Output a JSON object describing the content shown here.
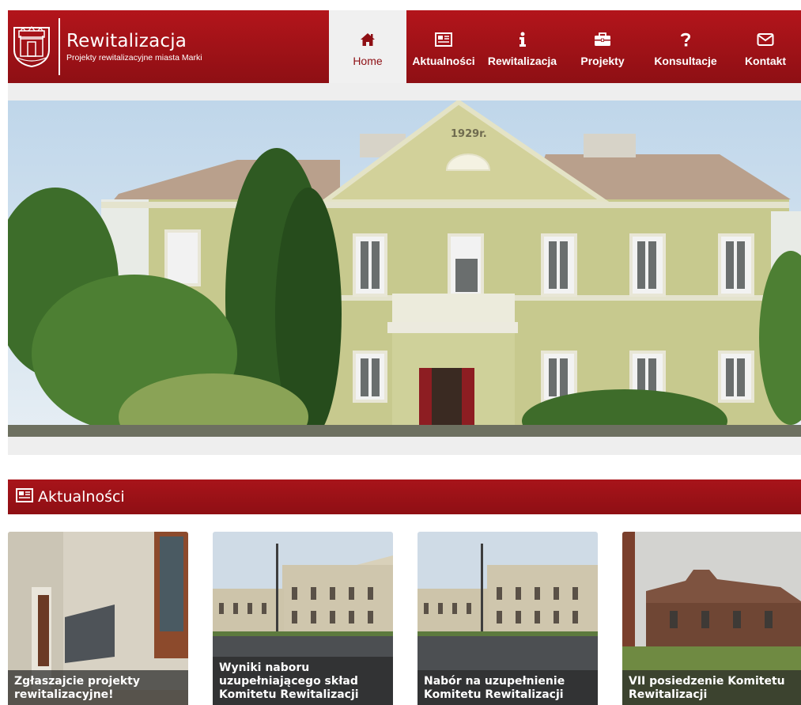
{
  "brand": {
    "title": "Rewitalizacja",
    "subtitle": "Projekty rewitalizacyjne miasta Marki",
    "logo_icon": "city-crest-icon"
  },
  "colors": {
    "brand_red": "#a8141a",
    "brand_red_dark": "#8e0f14",
    "active_tab_bg": "#f0f0f0"
  },
  "nav": {
    "items": [
      {
        "label": "Home",
        "icon": "home-icon",
        "active": true
      },
      {
        "label": "Aktualności",
        "icon": "newspaper-icon",
        "active": false
      },
      {
        "label": "Rewitalizacja",
        "icon": "info-icon",
        "active": false
      },
      {
        "label": "Projekty",
        "icon": "briefcase-icon",
        "active": false
      },
      {
        "label": "Konsultacje",
        "icon": "question-icon",
        "active": false
      },
      {
        "label": "Kontakt",
        "icon": "envelope-icon",
        "active": false
      }
    ]
  },
  "hero": {
    "building_date": "1929r."
  },
  "news": {
    "section_title": "Aktualności",
    "section_icon": "newspaper-icon",
    "items": [
      {
        "title": "Zgłaszajcie projekty rewitalizacyjne!"
      },
      {
        "title": "Wyniki naboru uzupełniającego skład Komitetu Rewitalizacji"
      },
      {
        "title": "Nabór na uzupełnienie Komitetu Rewitalizacji"
      },
      {
        "title": "VII posiedzenie Komitetu Rewitalizacji"
      }
    ]
  }
}
